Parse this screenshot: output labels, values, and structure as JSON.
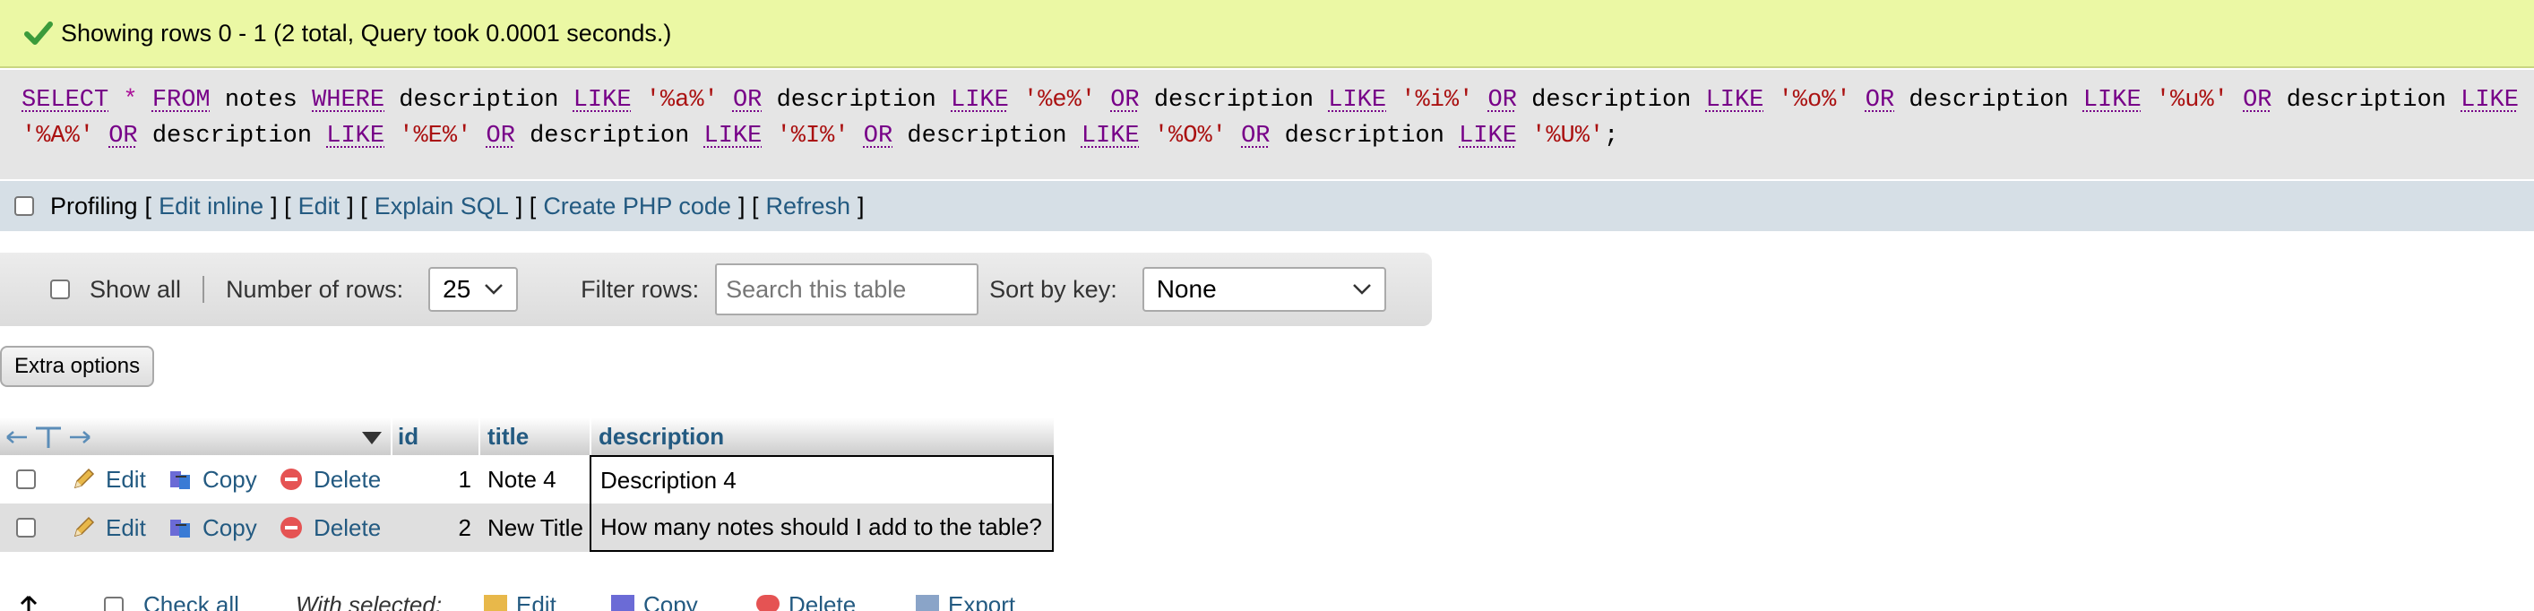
{
  "success": {
    "message": "Showing rows 0 - 1 (2 total, Query took 0.0001 seconds.)",
    "icon": "check-icon"
  },
  "sql": {
    "line1": [
      {
        "t": "kw",
        "v": "SELECT"
      },
      {
        "t": "sp",
        "v": " "
      },
      {
        "t": "op",
        "v": "*"
      },
      {
        "t": "sp",
        "v": " "
      },
      {
        "t": "kw",
        "v": "FROM"
      },
      {
        "t": "sp",
        "v": " "
      },
      {
        "t": "ident",
        "v": "notes"
      },
      {
        "t": "sp",
        "v": " "
      },
      {
        "t": "kw",
        "v": "WHERE"
      },
      {
        "t": "sp",
        "v": " "
      },
      {
        "t": "ident",
        "v": "description"
      },
      {
        "t": "sp",
        "v": " "
      },
      {
        "t": "kw",
        "v": "LIKE"
      },
      {
        "t": "sp",
        "v": " "
      },
      {
        "t": "str",
        "v": "'%a%'"
      },
      {
        "t": "sp",
        "v": " "
      },
      {
        "t": "kw",
        "v": "OR"
      },
      {
        "t": "sp",
        "v": " "
      },
      {
        "t": "ident",
        "v": "description"
      },
      {
        "t": "sp",
        "v": " "
      },
      {
        "t": "kw",
        "v": "LIKE"
      },
      {
        "t": "sp",
        "v": " "
      },
      {
        "t": "str",
        "v": "'%e%'"
      },
      {
        "t": "sp",
        "v": " "
      },
      {
        "t": "kw",
        "v": "OR"
      },
      {
        "t": "sp",
        "v": " "
      },
      {
        "t": "ident",
        "v": "description"
      },
      {
        "t": "sp",
        "v": " "
      },
      {
        "t": "kw",
        "v": "LIKE"
      },
      {
        "t": "sp",
        "v": " "
      },
      {
        "t": "str",
        "v": "'%i%'"
      },
      {
        "t": "sp",
        "v": " "
      },
      {
        "t": "kw",
        "v": "OR"
      },
      {
        "t": "sp",
        "v": " "
      },
      {
        "t": "ident",
        "v": "description"
      },
      {
        "t": "sp",
        "v": " "
      },
      {
        "t": "kw",
        "v": "LIKE"
      },
      {
        "t": "sp",
        "v": " "
      },
      {
        "t": "str",
        "v": "'%o%'"
      },
      {
        "t": "sp",
        "v": " "
      },
      {
        "t": "kw",
        "v": "OR"
      },
      {
        "t": "sp",
        "v": " "
      },
      {
        "t": "ident",
        "v": "description"
      },
      {
        "t": "sp",
        "v": " "
      },
      {
        "t": "kw",
        "v": "LIKE"
      },
      {
        "t": "sp",
        "v": " "
      },
      {
        "t": "str",
        "v": "'%u%'"
      },
      {
        "t": "sp",
        "v": " "
      },
      {
        "t": "kw",
        "v": "OR"
      },
      {
        "t": "sp",
        "v": " "
      },
      {
        "t": "ident",
        "v": "description"
      },
      {
        "t": "sp",
        "v": " "
      },
      {
        "t": "kw",
        "v": "LIKE"
      }
    ],
    "line2": [
      {
        "t": "str",
        "v": "'%A%'"
      },
      {
        "t": "sp",
        "v": " "
      },
      {
        "t": "kw",
        "v": "OR"
      },
      {
        "t": "sp",
        "v": " "
      },
      {
        "t": "ident",
        "v": "description"
      },
      {
        "t": "sp",
        "v": " "
      },
      {
        "t": "kw",
        "v": "LIKE"
      },
      {
        "t": "sp",
        "v": " "
      },
      {
        "t": "str",
        "v": "'%E%'"
      },
      {
        "t": "sp",
        "v": " "
      },
      {
        "t": "kw",
        "v": "OR"
      },
      {
        "t": "sp",
        "v": " "
      },
      {
        "t": "ident",
        "v": "description"
      },
      {
        "t": "sp",
        "v": " "
      },
      {
        "t": "kw",
        "v": "LIKE"
      },
      {
        "t": "sp",
        "v": " "
      },
      {
        "t": "str",
        "v": "'%I%'"
      },
      {
        "t": "sp",
        "v": " "
      },
      {
        "t": "kw",
        "v": "OR"
      },
      {
        "t": "sp",
        "v": " "
      },
      {
        "t": "ident",
        "v": "description"
      },
      {
        "t": "sp",
        "v": " "
      },
      {
        "t": "kw",
        "v": "LIKE"
      },
      {
        "t": "sp",
        "v": " "
      },
      {
        "t": "str",
        "v": "'%O%'"
      },
      {
        "t": "sp",
        "v": " "
      },
      {
        "t": "kw",
        "v": "OR"
      },
      {
        "t": "sp",
        "v": " "
      },
      {
        "t": "ident",
        "v": "description"
      },
      {
        "t": "sp",
        "v": " "
      },
      {
        "t": "kw",
        "v": "LIKE"
      },
      {
        "t": "sp",
        "v": " "
      },
      {
        "t": "str",
        "v": "'%U%'"
      },
      {
        "t": "ident",
        "v": ";"
      }
    ]
  },
  "profiling": {
    "label": "Profiling",
    "links": [
      "Edit inline",
      "Edit",
      "Explain SQL",
      "Create PHP code",
      "Refresh"
    ]
  },
  "nav": {
    "show_all": "Show all",
    "rows_label": "Number of rows:",
    "rows_value": "25",
    "filter_label": "Filter rows:",
    "filter_placeholder": "Search this table",
    "sort_label": "Sort by key:",
    "sort_value": "None"
  },
  "extra_options": "Extra options",
  "table": {
    "columns": [
      "id",
      "title",
      "description"
    ],
    "actions": {
      "edit": "Edit",
      "copy": "Copy",
      "delete": "Delete"
    },
    "rows": [
      {
        "id": "1",
        "title": "Note 4",
        "description": "Description 4"
      },
      {
        "id": "2",
        "title": "New Title",
        "description": "How many notes should I add to the table?"
      }
    ]
  },
  "bottom": {
    "check_all": "Check all",
    "with_selected": "With selected:",
    "edit": "Edit",
    "copy": "Copy",
    "delete": "Delete",
    "export": "Export"
  },
  "colors": {
    "success_bg": "#ebf8a4",
    "sql_bg": "#e5e5e5",
    "profiling_bg": "#d6dfe6",
    "link": "#235a81"
  }
}
